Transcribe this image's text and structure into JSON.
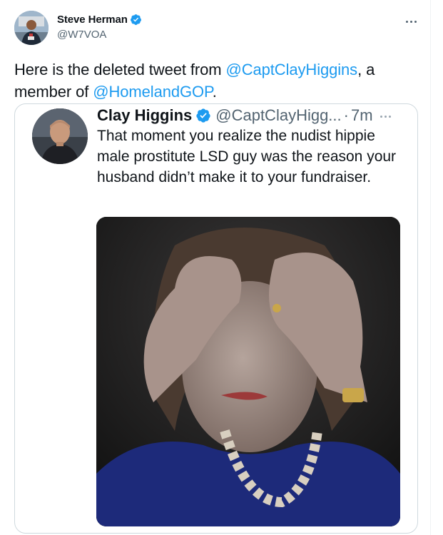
{
  "author": {
    "name": "Steve Herman",
    "handle": "@W7VOA",
    "verified": true
  },
  "menu_icon": "more-horizontal-icon",
  "tweet": {
    "text_1": "Here is the deleted tweet from ",
    "mention_1": "@CaptClayHiggins",
    "text_2": ", a member of ",
    "mention_2": "@HomelandGOP",
    "text_3": "."
  },
  "quoted": {
    "name": "Clay Higgins",
    "handle": "@CaptClayHigg...",
    "separator": "·",
    "time": "7m",
    "text": "That moment you realize the nudist hippie male prostitute LSD guy was the reason your husband didn’t make it to your fundraiser."
  },
  "colors": {
    "link": "#1d9bf0",
    "verified": "#1d9bf0",
    "secondary_text": "#536471",
    "border": "#cfd9de"
  }
}
